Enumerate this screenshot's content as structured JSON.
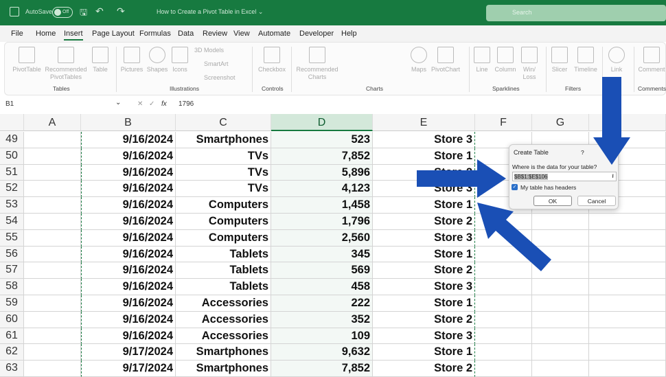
{
  "titlebar": {
    "autosave": "AutoSave",
    "toggle": "Off",
    "doc_title": "How to Create a Pivot Table in Excel ⌄",
    "search_placeholder": "Search"
  },
  "tabs": [
    "File",
    "Home",
    "Insert",
    "Page Layout",
    "Formulas",
    "Data",
    "Review",
    "View",
    "Automate",
    "Developer",
    "Help"
  ],
  "active_tab": "Insert",
  "ribbon": {
    "items": [
      "PivotTable",
      "Recommended PivotTables",
      "Table",
      "Pictures",
      "Shapes",
      "Icons",
      "3D Models",
      "SmartArt",
      "Screenshot",
      "Checkbox",
      "Recommended Charts",
      "Maps",
      "PivotChart",
      "Line",
      "Column",
      "Win/ Loss",
      "Slicer",
      "Timeline",
      "Link",
      "Comment"
    ],
    "groups": [
      "Tables",
      "Illustrations",
      "Controls",
      "Charts",
      "Sparklines",
      "Filters",
      "Comments"
    ]
  },
  "formula_bar": {
    "name_box": "B1",
    "fx": "fx",
    "value": "1796"
  },
  "columns": [
    "A",
    "B",
    "C",
    "D",
    "E",
    "F",
    "G"
  ],
  "selected_column": "D",
  "rows": [
    {
      "n": "49",
      "date": "9/16/2024",
      "product": "Smartphones",
      "qty": "523",
      "store": "Store 3"
    },
    {
      "n": "50",
      "date": "9/16/2024",
      "product": "TVs",
      "qty": "7,852",
      "store": "Store 1"
    },
    {
      "n": "51",
      "date": "9/16/2024",
      "product": "TVs",
      "qty": "5,896",
      "store": "Store 2"
    },
    {
      "n": "52",
      "date": "9/16/2024",
      "product": "TVs",
      "qty": "4,123",
      "store": "Store 3"
    },
    {
      "n": "53",
      "date": "9/16/2024",
      "product": "Computers",
      "qty": "1,458",
      "store": "Store 1"
    },
    {
      "n": "54",
      "date": "9/16/2024",
      "product": "Computers",
      "qty": "1,796",
      "store": "Store 2"
    },
    {
      "n": "55",
      "date": "9/16/2024",
      "product": "Computers",
      "qty": "2,560",
      "store": "Store 3"
    },
    {
      "n": "56",
      "date": "9/16/2024",
      "product": "Tablets",
      "qty": "345",
      "store": "Store 1"
    },
    {
      "n": "57",
      "date": "9/16/2024",
      "product": "Tablets",
      "qty": "569",
      "store": "Store 2"
    },
    {
      "n": "58",
      "date": "9/16/2024",
      "product": "Tablets",
      "qty": "458",
      "store": "Store 3"
    },
    {
      "n": "59",
      "date": "9/16/2024",
      "product": "Accessories",
      "qty": "222",
      "store": "Store 1"
    },
    {
      "n": "60",
      "date": "9/16/2024",
      "product": "Accessories",
      "qty": "352",
      "store": "Store 2"
    },
    {
      "n": "61",
      "date": "9/16/2024",
      "product": "Accessories",
      "qty": "109",
      "store": "Store 3"
    },
    {
      "n": "62",
      "date": "9/17/2024",
      "product": "Smartphones",
      "qty": "9,632",
      "store": "Store 1"
    },
    {
      "n": "63",
      "date": "9/17/2024",
      "product": "Smartphones",
      "qty": "7,852",
      "store": "Store 2"
    }
  ],
  "dialog": {
    "title": "Create Table",
    "help": "?",
    "prompt": "Where is the data for your table?",
    "range": "$B$1:$E$106",
    "headers_label": "My table has headers",
    "headers_checked": true,
    "ok": "OK",
    "cancel": "Cancel"
  },
  "colors": {
    "brand": "#177a40",
    "arrow": "#1a4fb5"
  }
}
